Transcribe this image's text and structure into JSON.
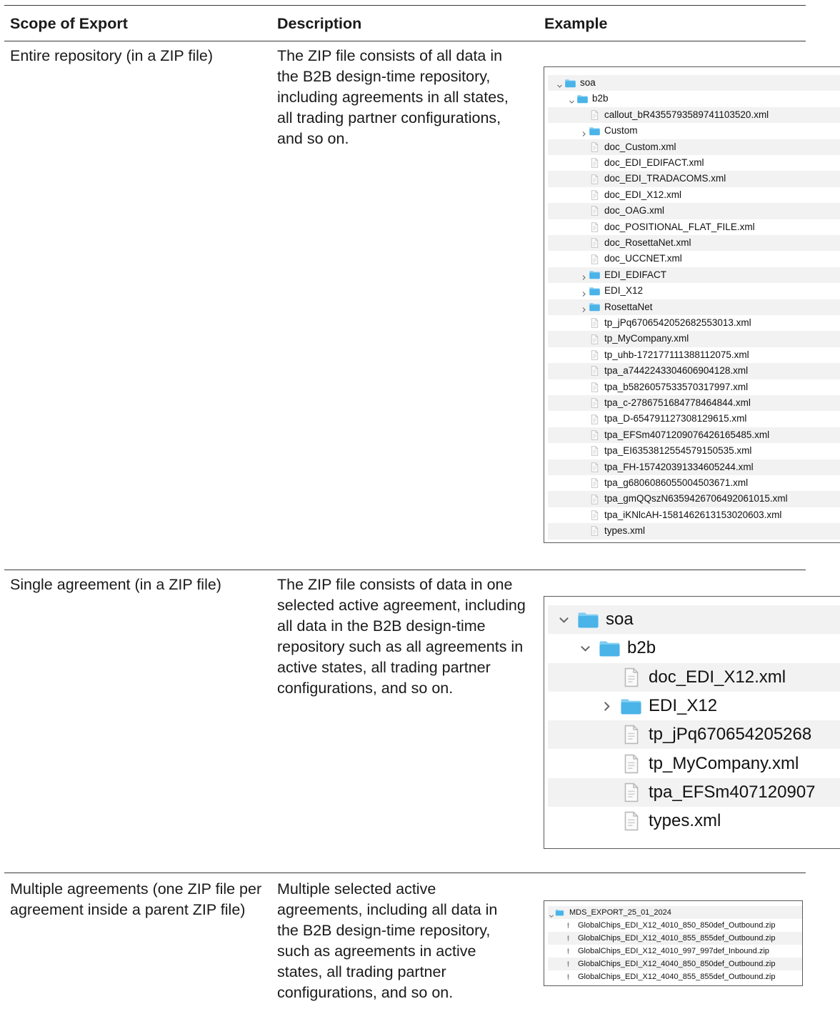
{
  "table": {
    "headers": [
      "Scope of Export",
      "Description",
      "Example"
    ],
    "rows": [
      {
        "scope": "Entire repository (in a ZIP file)",
        "description": "The ZIP file consists of all data in the B2B design-time repository, including agreements in all states, all trading partner configurations, and so on."
      },
      {
        "scope": "Single agreement (in a ZIP file)",
        "description": "The ZIP file consists of data in one selected active agreement, including all data in the B2B design-time repository such as all agreements in active states, all trading partner configurations, and so on."
      },
      {
        "scope": "Multiple agreements (one ZIP file per agreement inside a parent ZIP file)",
        "description": "Multiple selected active agreements, including all data in the B2B design-time repository, such as agreements in active states, all trading partner configurations, and so on."
      }
    ]
  },
  "example1": {
    "items": [
      {
        "label": "soa",
        "kind": "folder",
        "chevron": "down",
        "level": 0
      },
      {
        "label": "b2b",
        "kind": "folder",
        "chevron": "down",
        "level": 1
      },
      {
        "label": "callout_bR4355793589741103520.xml",
        "kind": "file",
        "level": 2
      },
      {
        "label": "Custom",
        "kind": "folder",
        "chevron": "right",
        "level": 2
      },
      {
        "label": "doc_Custom.xml",
        "kind": "file",
        "level": 2
      },
      {
        "label": "doc_EDI_EDIFACT.xml",
        "kind": "file",
        "level": 2
      },
      {
        "label": "doc_EDI_TRADACOMS.xml",
        "kind": "file",
        "level": 2
      },
      {
        "label": "doc_EDI_X12.xml",
        "kind": "file",
        "level": 2
      },
      {
        "label": "doc_OAG.xml",
        "kind": "file",
        "level": 2
      },
      {
        "label": "doc_POSITIONAL_FLAT_FILE.xml",
        "kind": "file",
        "level": 2
      },
      {
        "label": "doc_RosettaNet.xml",
        "kind": "file",
        "level": 2
      },
      {
        "label": "doc_UCCNET.xml",
        "kind": "file",
        "level": 2
      },
      {
        "label": "EDI_EDIFACT",
        "kind": "folder",
        "chevron": "right",
        "level": 2
      },
      {
        "label": "EDI_X12",
        "kind": "folder",
        "chevron": "right",
        "level": 2
      },
      {
        "label": "RosettaNet",
        "kind": "folder",
        "chevron": "right",
        "level": 2
      },
      {
        "label": "tp_jPq6706542052682553013.xml",
        "kind": "file",
        "level": 2
      },
      {
        "label": "tp_MyCompany.xml",
        "kind": "file",
        "level": 2
      },
      {
        "label": "tp_uhb-172177111388112075.xml",
        "kind": "file",
        "level": 2
      },
      {
        "label": "tpa_a7442243304606904128.xml",
        "kind": "file",
        "level": 2
      },
      {
        "label": "tpa_b5826057533570317997.xml",
        "kind": "file",
        "level": 2
      },
      {
        "label": "tpa_c-2786751684778464844.xml",
        "kind": "file",
        "level": 2
      },
      {
        "label": "tpa_D-654791127308129615.xml",
        "kind": "file",
        "level": 2
      },
      {
        "label": "tpa_EFSm4071209076426165485.xml",
        "kind": "file",
        "level": 2
      },
      {
        "label": "tpa_EI6353812554579150535.xml",
        "kind": "file",
        "level": 2
      },
      {
        "label": "tpa_FH-157420391334605244.xml",
        "kind": "file",
        "level": 2
      },
      {
        "label": "tpa_g6806086055004503671.xml",
        "kind": "file",
        "level": 2
      },
      {
        "label": "tpa_gmQQszN6359426706492061015.xml",
        "kind": "file",
        "level": 2
      },
      {
        "label": "tpa_iKNlcAH-1581462613153020603.xml",
        "kind": "file",
        "level": 2
      },
      {
        "label": "types.xml",
        "kind": "file",
        "level": 2
      }
    ]
  },
  "example2": {
    "items": [
      {
        "label": "soa",
        "kind": "folder",
        "chevron": "down",
        "level": 0
      },
      {
        "label": "b2b",
        "kind": "folder",
        "chevron": "down",
        "level": 1
      },
      {
        "label": "doc_EDI_X12.xml",
        "kind": "file",
        "level": 2
      },
      {
        "label": "EDI_X12",
        "kind": "folder",
        "chevron": "right",
        "level": 2
      },
      {
        "label": "tp_jPq670654205268",
        "kind": "file",
        "level": 2
      },
      {
        "label": "tp_MyCompany.xml",
        "kind": "file",
        "level": 2
      },
      {
        "label": "tpa_EFSm407120907",
        "kind": "file",
        "level": 2
      },
      {
        "label": "types.xml",
        "kind": "file",
        "level": 2
      }
    ]
  },
  "example3": {
    "items": [
      {
        "label": "MDS_EXPORT_25_01_2024",
        "kind": "folder",
        "chevron": "down",
        "level": 0
      },
      {
        "label": "GlobalChips_EDI_X12_4010_850_850def_Outbound.zip",
        "kind": "zip",
        "level": 1
      },
      {
        "label": "GlobalChips_EDI_X12_4010_855_855def_Outbound.zip",
        "kind": "zip",
        "level": 1
      },
      {
        "label": "GlobalChips_EDI_X12_4010_997_997def_Inbound.zip",
        "kind": "zip",
        "level": 1
      },
      {
        "label": "GlobalChips_EDI_X12_4040_850_850def_Outbound.zip",
        "kind": "zip",
        "level": 1
      },
      {
        "label": "GlobalChips_EDI_X12_4040_855_855def_Outbound.zip",
        "kind": "zip",
        "level": 1
      }
    ]
  },
  "colors": {
    "folder": "#4ab3e8",
    "folder_tab": "#7fcdf2",
    "file_border": "#b9b9b9",
    "row_alt": "#f2f2f3"
  }
}
